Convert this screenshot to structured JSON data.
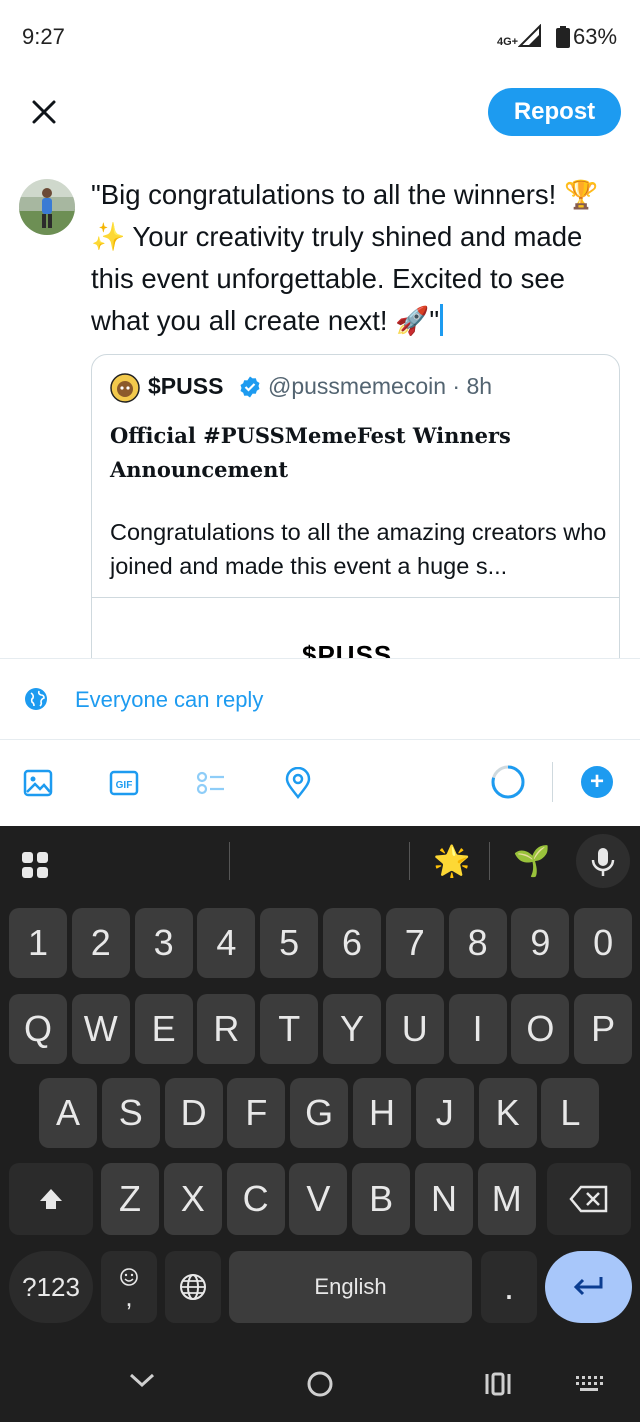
{
  "status_bar": {
    "time": "9:27",
    "network": "4G+",
    "battery": "63%"
  },
  "header": {
    "repost_label": "Repost"
  },
  "compose": {
    "text": "\"Big congratulations to all the winners! 🏆✨ Your creativity truly shined and made this event unforgettable. Excited to see what you all create next! 🚀\""
  },
  "quote": {
    "name": "$PUSS",
    "handle": "@pussmemecoin · 8h",
    "title": "Official #PUSSMemeFest Winners Announcement",
    "body": "Congratulations to all the amazing creators who joined and made this event a huge s...",
    "media_text": "$PUSS"
  },
  "reply": {
    "label": "Everyone can reply"
  },
  "toolbar": {
    "icons": [
      "image-icon",
      "gif-icon",
      "poll-icon",
      "location-icon"
    ],
    "add_label": "+"
  },
  "keyboard": {
    "suggestions": [
      "🌟",
      "🌱"
    ],
    "row_numbers": [
      "1",
      "2",
      "3",
      "4",
      "5",
      "6",
      "7",
      "8",
      "9",
      "0"
    ],
    "row_top": [
      "Q",
      "W",
      "E",
      "R",
      "T",
      "Y",
      "U",
      "I",
      "O",
      "P"
    ],
    "row_middle": [
      "A",
      "S",
      "D",
      "F",
      "G",
      "H",
      "J",
      "K",
      "L"
    ],
    "row_bottom": [
      "Z",
      "X",
      "C",
      "V",
      "B",
      "N",
      "M"
    ],
    "symbols_label": "?123",
    "comma": ",",
    "space_label": "English",
    "period": "."
  }
}
